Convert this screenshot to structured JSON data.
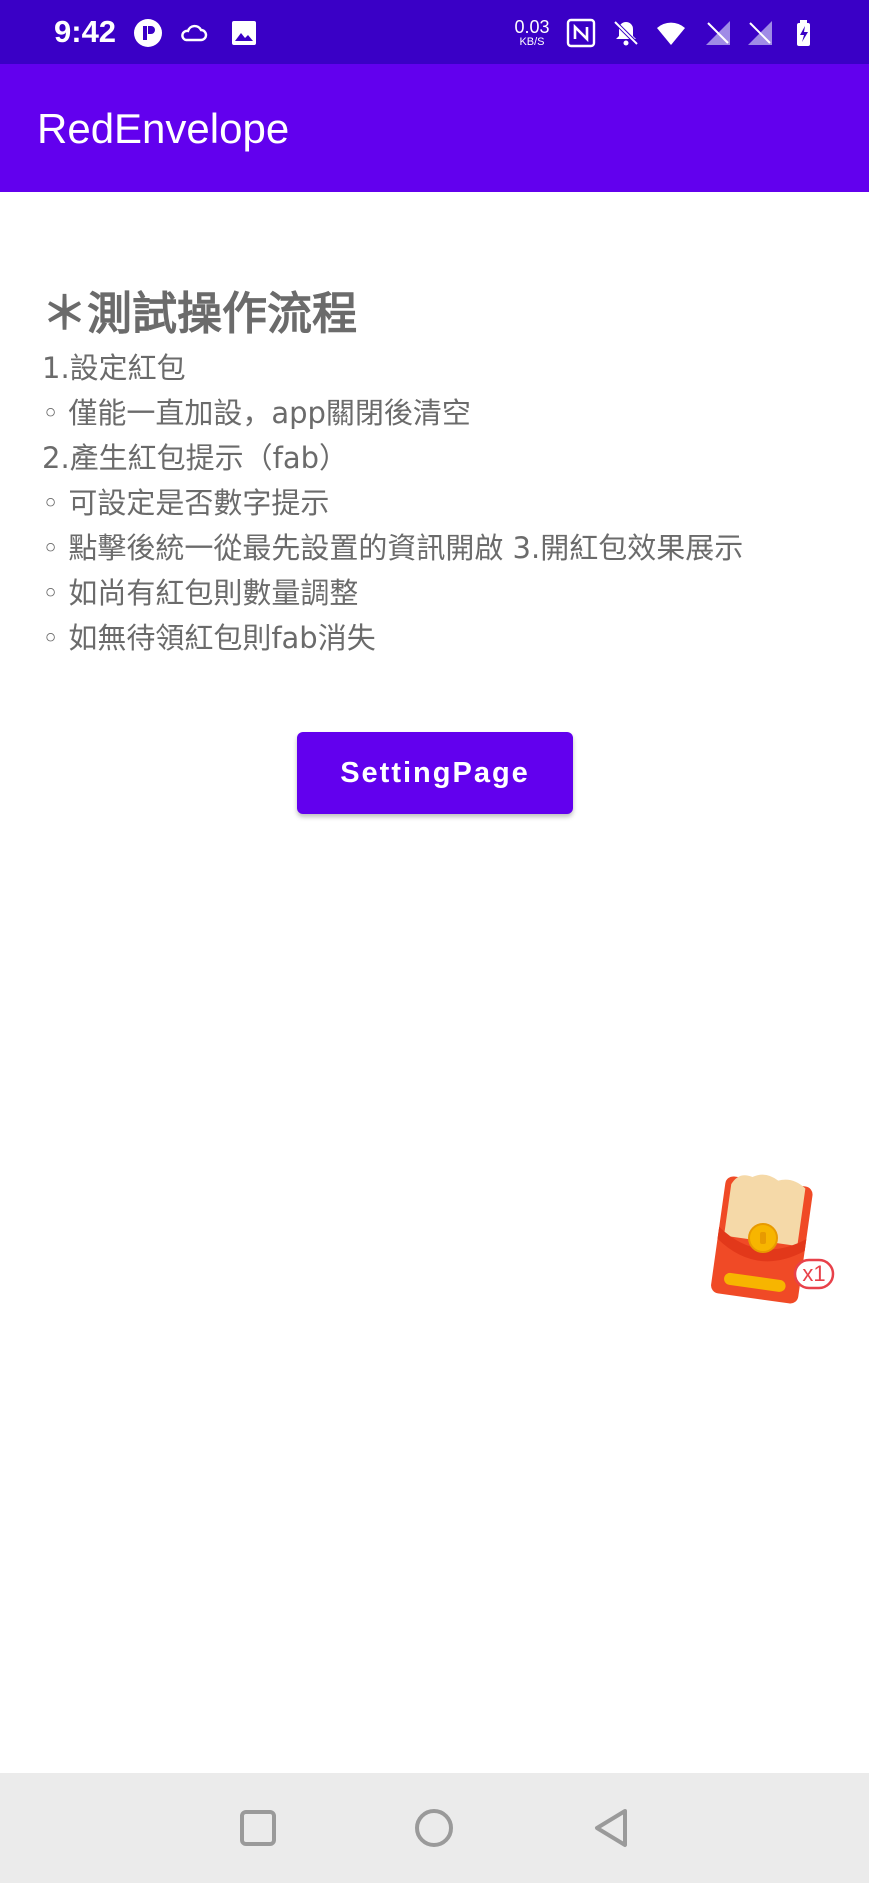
{
  "status_bar": {
    "time": "9:42",
    "net_speed_value": "0.03",
    "net_speed_unit": "KB/S",
    "icons": [
      "app-notification-icon",
      "cloud-icon",
      "image-icon",
      "nfc-icon",
      "bell-off-icon",
      "wifi-icon",
      "signal-icon",
      "signal-icon-2",
      "battery-charging-icon"
    ]
  },
  "app_bar": {
    "title": "RedEnvelope"
  },
  "content": {
    "heading": "＊測試操作流程",
    "lines": [
      "1.設定紅包",
      "◦ 僅能一直加設，app關閉後清空",
      "2.產生紅包提示（fab）",
      "◦ 可設定是否數字提示",
      "◦ 點擊後統一從最先設置的資訊開啟 3.開紅包效果展示",
      "◦ 如尚有紅包則數量調整",
      "◦ 如無待領紅包則fab消失"
    ]
  },
  "button": {
    "label": "SettingPage"
  },
  "fab": {
    "badge": "x1",
    "colors": {
      "envelope": "#F04A26",
      "flap": "#F5D9A8",
      "coin": "#F7B500",
      "badge_border": "#E8414A"
    }
  },
  "nav_bar": {
    "icons": [
      "recent-apps-icon",
      "home-icon",
      "back-icon"
    ]
  },
  "colors": {
    "status_bar": "#3A00C6",
    "app_bar": "#6200EE",
    "button": "#6200EE",
    "text": "#6B6B6B",
    "nav_bar": "#EBEBEB"
  }
}
